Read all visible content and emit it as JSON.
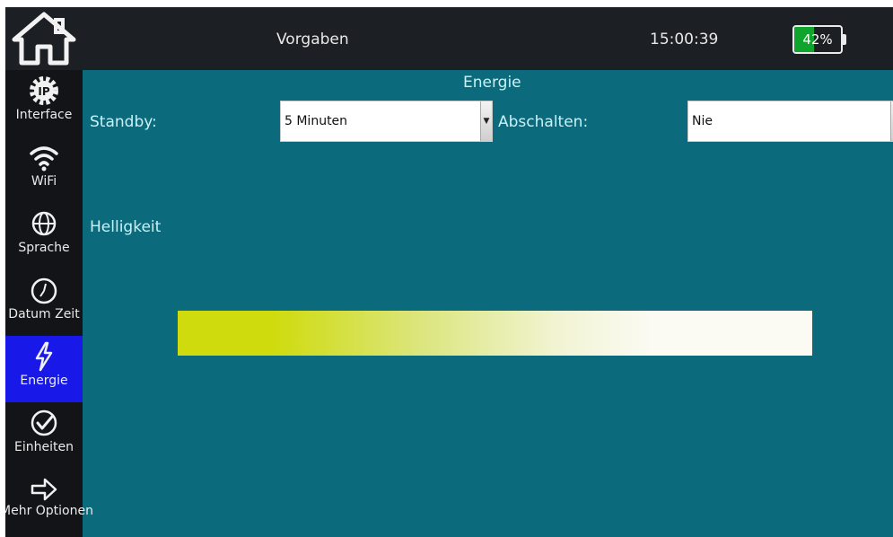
{
  "header": {
    "title": "Vorgaben",
    "clock": "15:00:39",
    "battery": {
      "label": "42%",
      "level": 0.42
    }
  },
  "sidebar": {
    "items": [
      {
        "label": "Interface",
        "icon": "ip-gear-icon"
      },
      {
        "label": "WiFi",
        "icon": "wifi-icon"
      },
      {
        "label": "Sprache",
        "icon": "globe-icon"
      },
      {
        "label": "Datum Zeit",
        "icon": "clock-icon"
      },
      {
        "label": "Energie",
        "icon": "lightning-icon",
        "active": true
      },
      {
        "label": "Einheiten",
        "icon": "check-circle-icon"
      },
      {
        "label": "Mehr Optionen",
        "icon": "arrow-right-icon"
      }
    ]
  },
  "main": {
    "section_title": "Energie",
    "standby": {
      "label": "Standby:",
      "value": "5 Minuten"
    },
    "abschalten": {
      "label": "Abschalten:",
      "value": "Nie"
    },
    "helligkeit": {
      "label": "Helligkeit",
      "level": 0.75
    }
  },
  "colors": {
    "background": "#0b6a7c",
    "topbar": "#1c1f23",
    "sidebar": "#121417",
    "active_nav": "#1818e8",
    "battery": "#0fa42b",
    "slider_fill": "#cfdb0d"
  }
}
